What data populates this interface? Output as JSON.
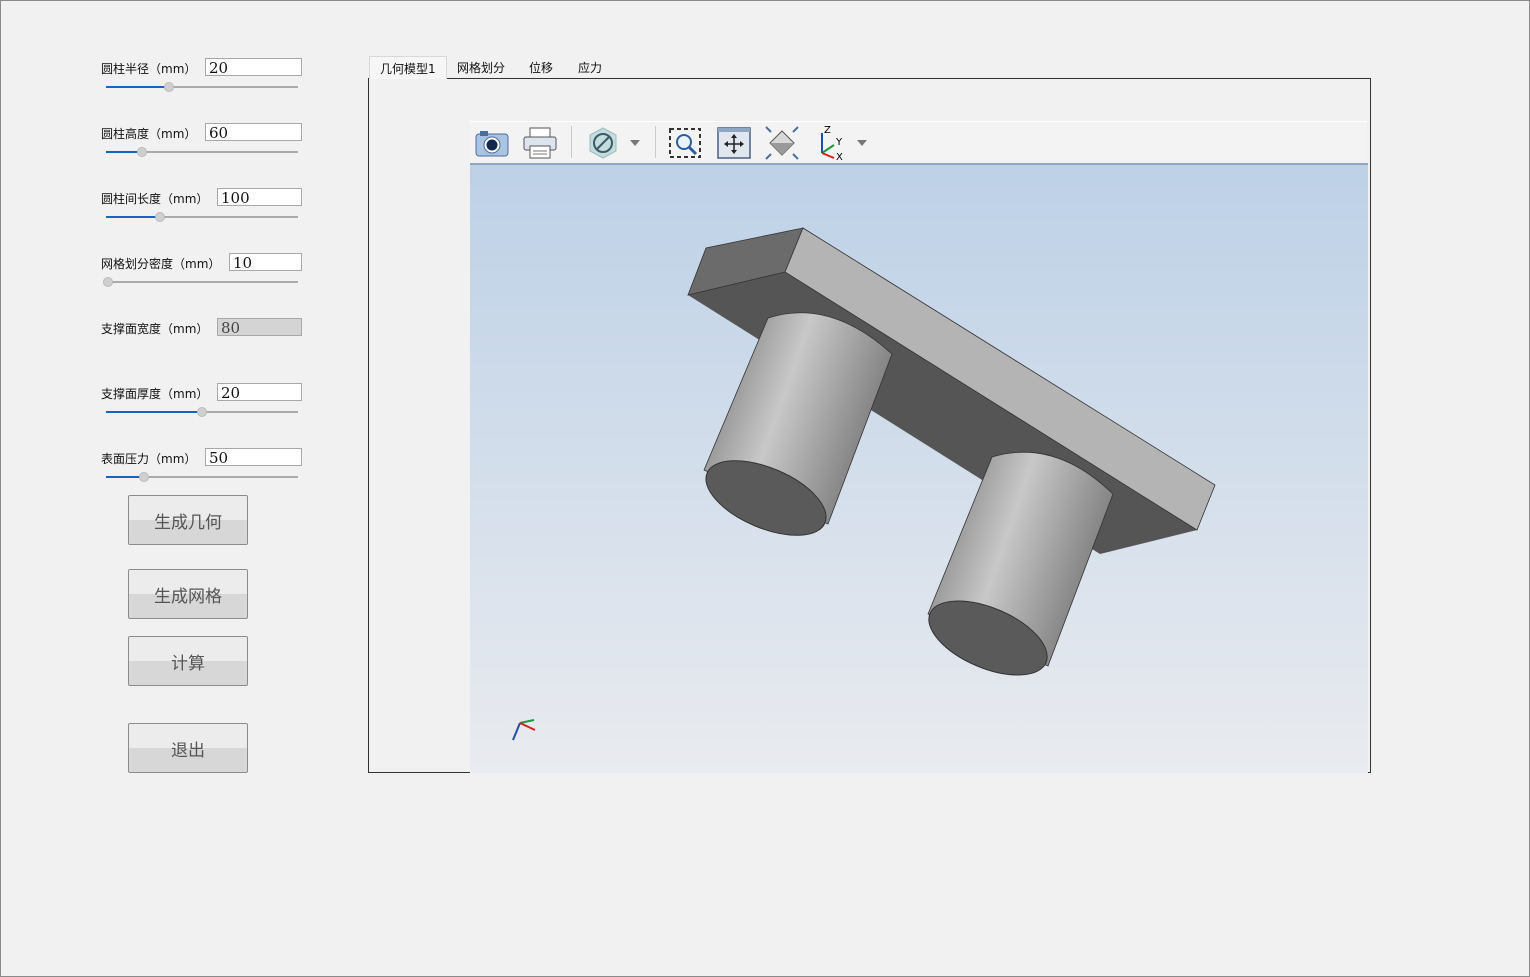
{
  "params": [
    {
      "label": "圆柱半径（mm）",
      "value": "20",
      "slider": 0.33,
      "enabled": true
    },
    {
      "label": "圆柱高度（mm）",
      "value": "60",
      "slider": 0.19,
      "enabled": true
    },
    {
      "label": "圆柱间长度（mm）",
      "value": "100",
      "slider": 0.28,
      "enabled": true
    },
    {
      "label": "网格划分密度（mm）",
      "value": "10",
      "slider": 0.0,
      "enabled": true
    },
    {
      "label": "支撑面宽度（mm）",
      "value": "80",
      "enabled": false
    },
    {
      "label": "支撑面厚度（mm）",
      "value": "20",
      "slider": 0.5,
      "enabled": true
    },
    {
      "label": "表面压力（mm）",
      "value": "50",
      "slider": 0.2,
      "enabled": true
    }
  ],
  "buttons": {
    "generate_geometry": "生成几何",
    "generate_mesh": "生成网格",
    "compute": "计算",
    "exit": "退出"
  },
  "tabs": [
    "几何模型1",
    "网格划分",
    "位移",
    "应力"
  ],
  "toolbar": [
    "camera-icon",
    "print-icon",
    "display-mode-icon",
    "zoom-box-icon",
    "pan-icon",
    "fit-all-icon",
    "axes-icon"
  ],
  "axes": {
    "x": "X",
    "y": "Y",
    "z": "Z"
  },
  "colors": {
    "accent": "#1565c0",
    "model_light": "#b4b4b4",
    "model_dark": "#555555"
  }
}
